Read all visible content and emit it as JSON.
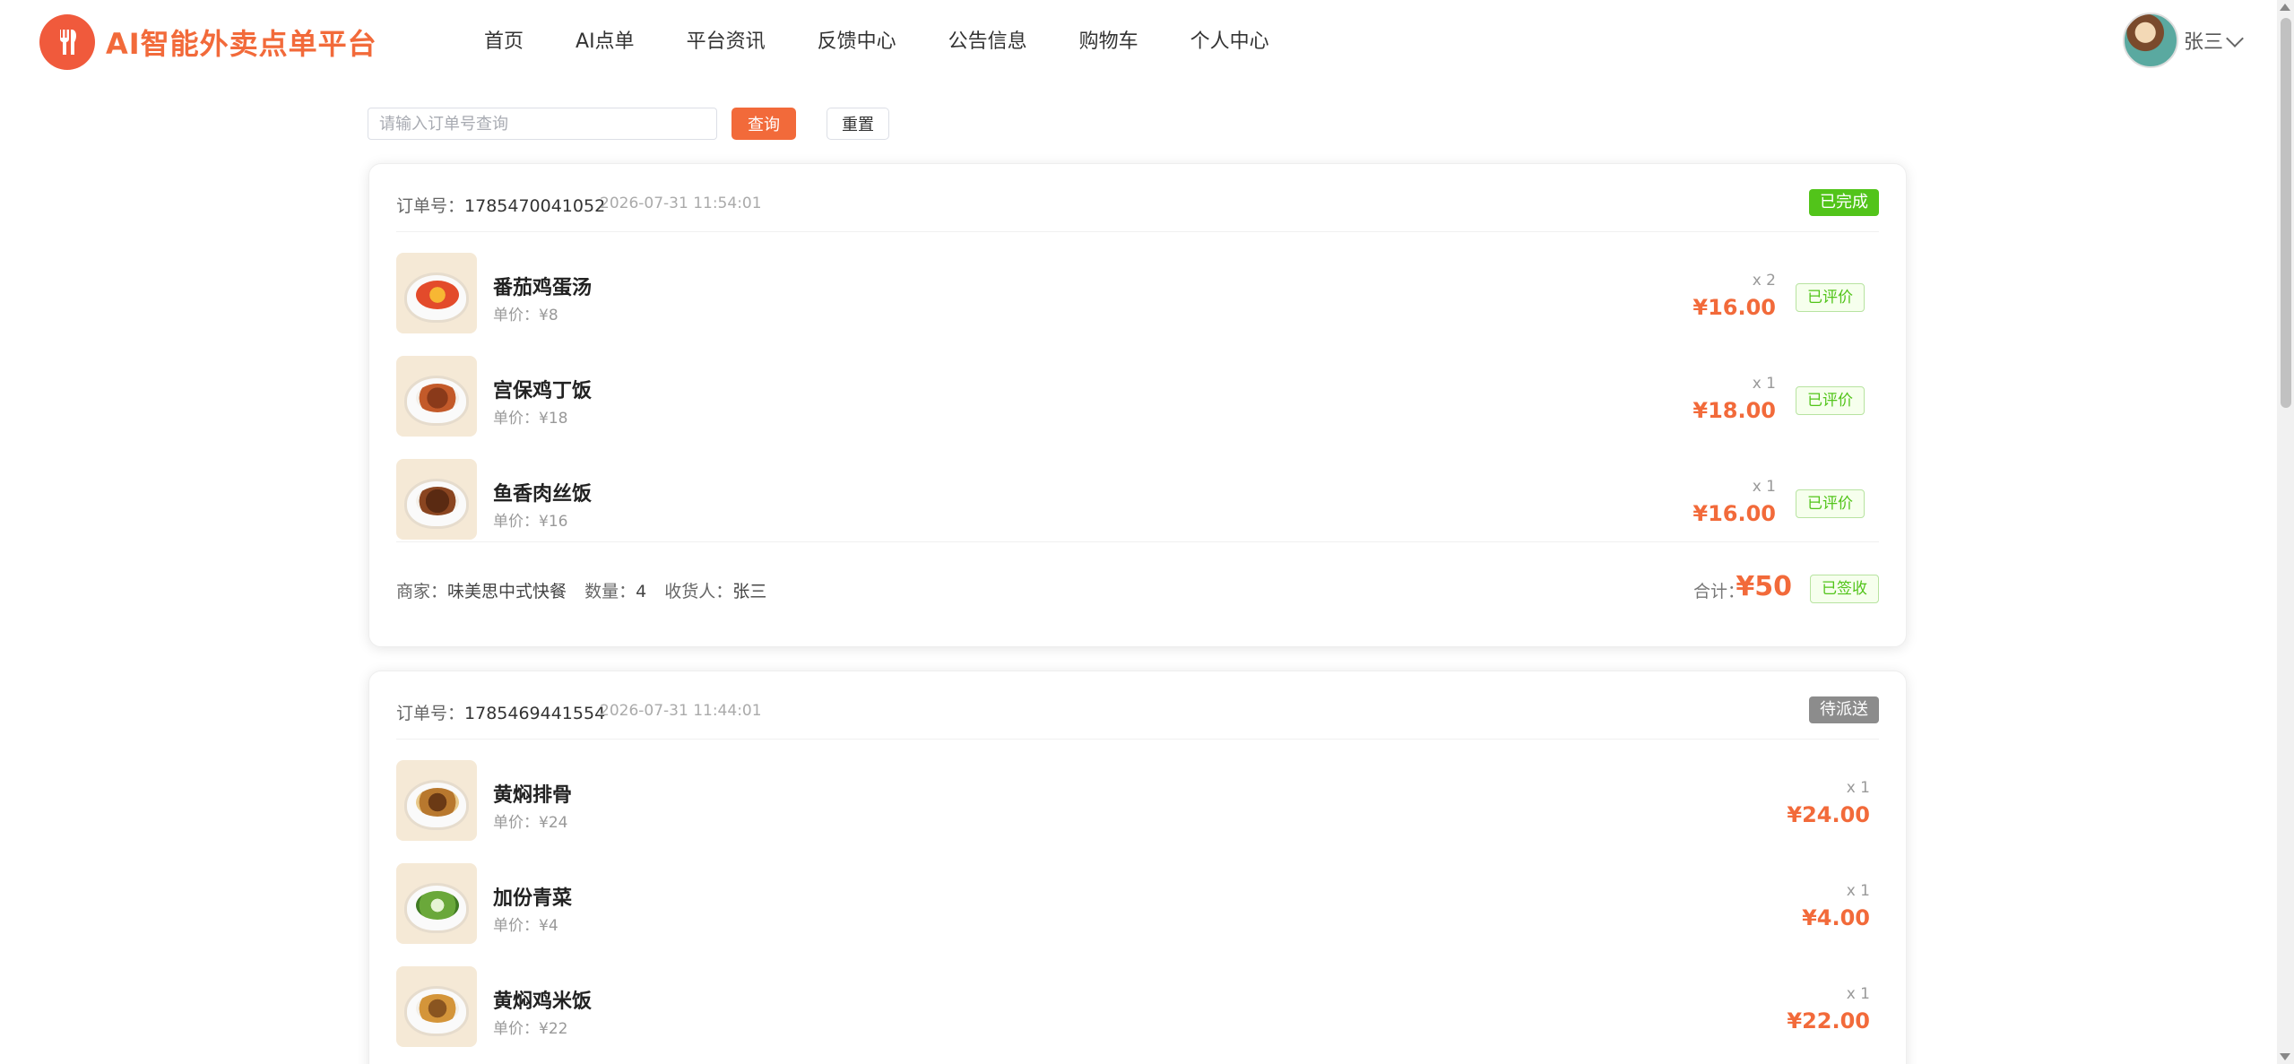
{
  "header": {
    "brand": "AI智能外卖点单平台",
    "nav": [
      "首页",
      "AI点单",
      "平台资讯",
      "反馈中心",
      "公告信息",
      "购物车",
      "个人中心"
    ],
    "user_name": "张三"
  },
  "search": {
    "placeholder": "请输入订单号查询",
    "query_label": "查询",
    "reset_label": "重置"
  },
  "labels": {
    "order_no": "订单号：",
    "unit_price": "单价：",
    "merchant": "商家：",
    "quantity": "数量：",
    "receiver": "收货人：",
    "total": "合计："
  },
  "orders": [
    {
      "order_no": "1785470041052",
      "time": "2026-07-31 11:54:01",
      "status": "已完成",
      "items": [
        {
          "name": "番茄鸡蛋汤",
          "unit_price": "¥8",
          "qty": "x 2",
          "subtotal": "¥16.00",
          "review": "已评价"
        },
        {
          "name": "宫保鸡丁饭",
          "unit_price": "¥18",
          "qty": "x 1",
          "subtotal": "¥18.00",
          "review": "已评价"
        },
        {
          "name": "鱼香肉丝饭",
          "unit_price": "¥16",
          "qty": "x 1",
          "subtotal": "¥16.00",
          "review": "已评价"
        }
      ],
      "merchant": "味美思中式快餐",
      "quantity": "4",
      "receiver": "张三",
      "total": "¥50",
      "sign_status": "已签收"
    },
    {
      "order_no": "1785469441554",
      "time": "2026-07-31 11:44:01",
      "status": "待派送",
      "items": [
        {
          "name": "黄焖排骨",
          "unit_price": "¥24",
          "qty": "x 1",
          "subtotal": "¥24.00"
        },
        {
          "name": "加份青菜",
          "unit_price": "¥4",
          "qty": "x 1",
          "subtotal": "¥4.00"
        },
        {
          "name": "黄焖鸡米饭",
          "unit_price": "¥22",
          "qty": "x 1",
          "subtotal": "¥22.00"
        }
      ]
    }
  ],
  "colors": {
    "accent": "#f26a3a",
    "success": "#52c41a",
    "pending": "#8c8c8c"
  }
}
